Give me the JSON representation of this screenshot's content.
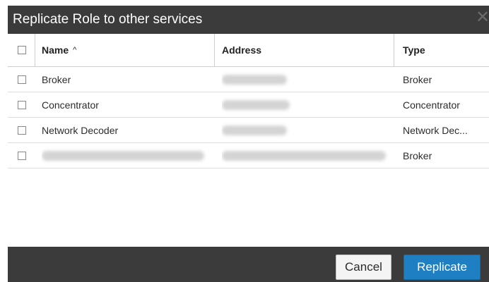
{
  "dialog": {
    "title": "Replicate Role to other services",
    "close_icon": "close-icon"
  },
  "table": {
    "columns": {
      "name": "Name",
      "sort_indicator": "^",
      "address": "Address",
      "type": "Type"
    },
    "rows": [
      {
        "name": "Broker",
        "address_redacted": true,
        "type": "Broker"
      },
      {
        "name": "Concentrator",
        "address_redacted": true,
        "type": "Concentrator"
      },
      {
        "name": "Network Decoder",
        "address_redacted": true,
        "type": "Network Dec..."
      },
      {
        "name_redacted": true,
        "address_redacted": true,
        "type": "Broker"
      }
    ]
  },
  "footer": {
    "cancel_label": "Cancel",
    "replicate_label": "Replicate",
    "replicate_color": "#1e7fc3"
  }
}
